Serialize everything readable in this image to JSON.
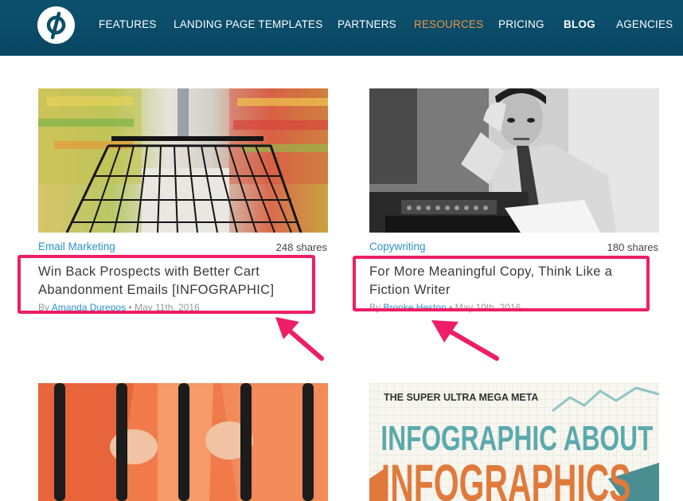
{
  "header": {
    "logo": "unbounce-logo-icon",
    "nav": [
      {
        "label": "FEATURES"
      },
      {
        "label": "LANDING PAGE TEMPLATES"
      },
      {
        "label": "PARTNERS"
      },
      {
        "label": "RESOURCES"
      },
      {
        "label": "PRICING"
      },
      {
        "label": "BLOG"
      },
      {
        "label": "AGENCIES"
      }
    ],
    "active_item": "RESOURCES",
    "colors": {
      "bar": "#0b4f6c",
      "active": "#f29547",
      "text": "#ffffff"
    }
  },
  "posts": [
    {
      "category": "Email Marketing",
      "shares": "248 shares",
      "title": "Win Back Prospects with Better Cart Abandonment Emails [INFOGRAPHIC]",
      "byline_prefix": "By ",
      "author": "Amanda Durepos",
      "date": " • May 11th, 2016",
      "image": "shopping-cart-photo"
    },
    {
      "category": "Copywriting",
      "shares": "180 shares",
      "title": "For More Meaningful Copy, Think Like a Fiction Writer",
      "byline_prefix": "By ",
      "author": "Brooke Heston",
      "date": " • May 10th, 2016",
      "image": "writer-at-typewriter-photo"
    },
    {
      "image": "prison-bars-photo"
    },
    {
      "image": "infographic-about-infographics-image",
      "image_text": {
        "line1": "THE SUPER ULTRA MEGA META",
        "line2": "INFOGRAPHIC ABOUT",
        "line3": "INFOGRAPHICS"
      }
    }
  ],
  "annotation_color": "#ee1e66"
}
